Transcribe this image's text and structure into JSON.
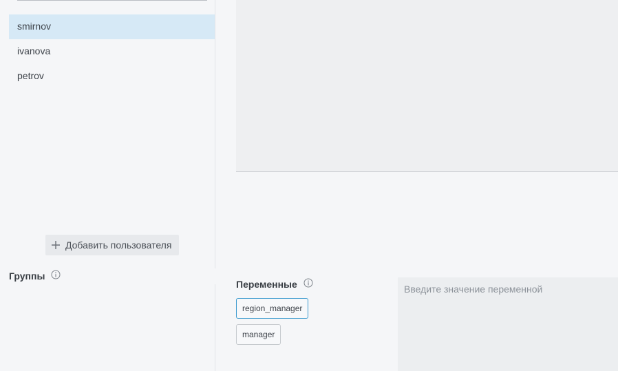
{
  "users": {
    "items": [
      {
        "label": "smirnov",
        "selected": true
      },
      {
        "label": "ivanova",
        "selected": false
      },
      {
        "label": "petrov",
        "selected": false
      }
    ],
    "add_button_label": "Добавить пользователя",
    "add_button_icon": "plus-icon"
  },
  "groups": {
    "title": "Группы",
    "info_icon": "info-icon"
  },
  "variables": {
    "title": "Переменные",
    "info_icon": "info-icon",
    "items": [
      {
        "label": "region_manager",
        "active": true
      },
      {
        "label": "manager",
        "active": false
      }
    ],
    "value_placeholder": "Введите значение переменной",
    "value": ""
  },
  "colors": {
    "selected_row": "#d6e9f6",
    "active_chip_border": "#3d9bcf",
    "background": "#f5f6f8"
  }
}
